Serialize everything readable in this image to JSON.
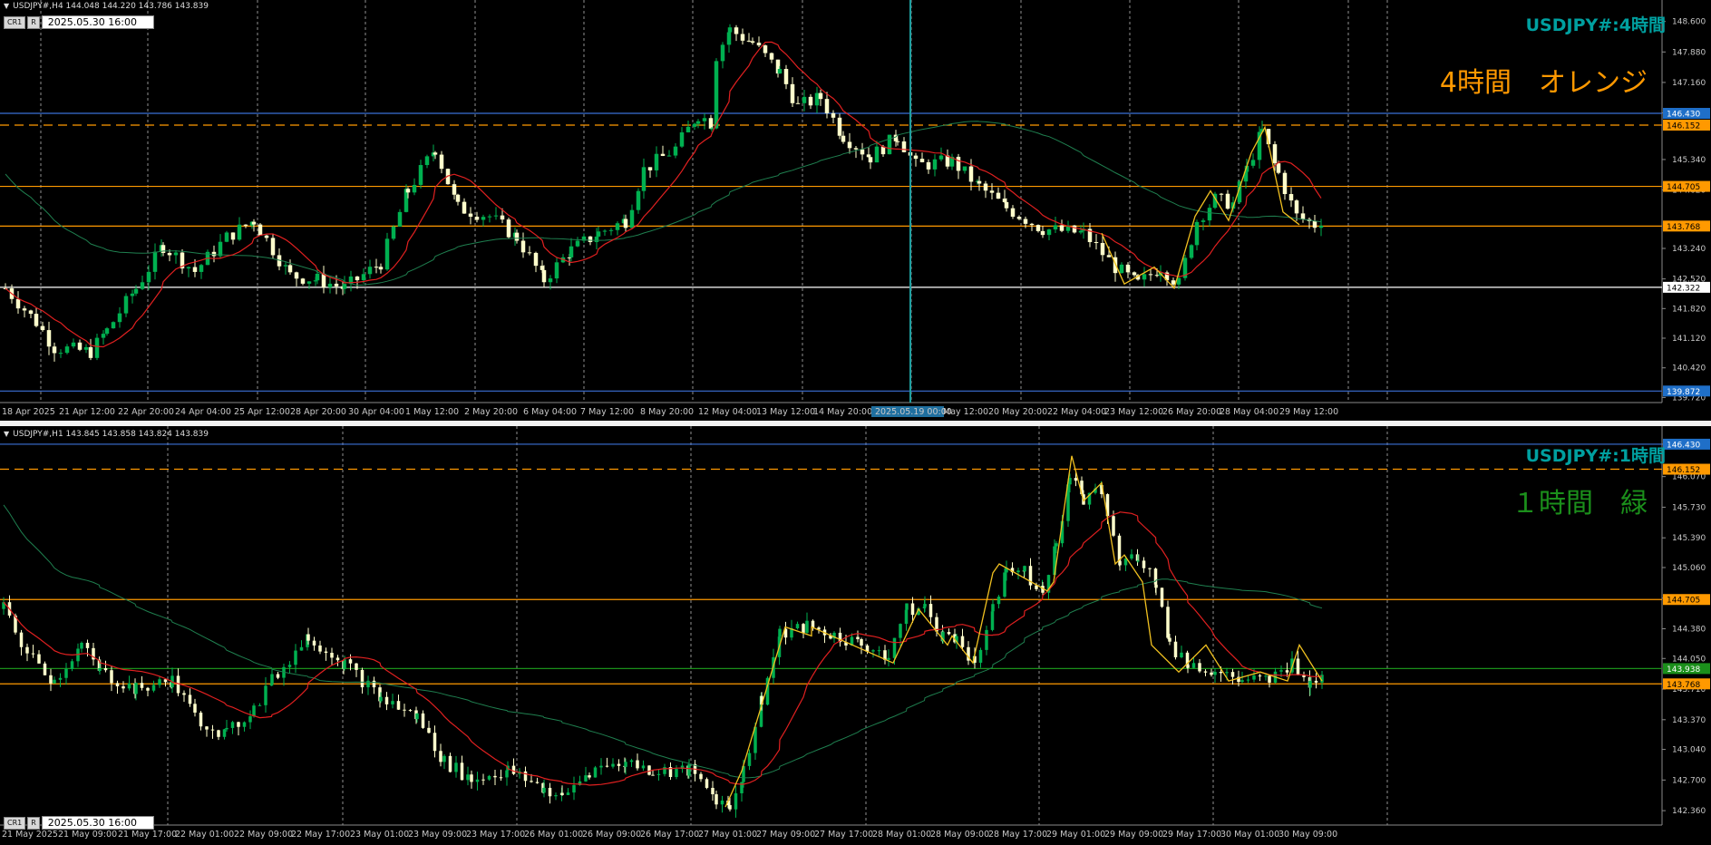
{
  "top": {
    "header": "USDJPY#,H4  144.048 144.220 143.786 143.839",
    "toolbar": {
      "btn1": "CR1",
      "btn2": "R",
      "date": "2025.05.30 16:00"
    },
    "title": "USDJPY#:4時間",
    "label": "4時間　オレンジ",
    "price_ticks": [
      "148.600",
      "147.880",
      "147.160",
      "146.440",
      "145.340",
      "144.620",
      "143.240",
      "142.520",
      "141.820",
      "141.120",
      "140.420",
      "139.720"
    ],
    "hlines": [
      {
        "value": "146.430",
        "color": "#3b6fd6",
        "style": "solid",
        "tag_bg": "#1f6fc8"
      },
      {
        "value": "146.152",
        "color": "#ff9900",
        "style": "dashed",
        "tag_bg": "#ff9900"
      },
      {
        "value": "144.705",
        "color": "#ff9900",
        "style": "solid",
        "tag_bg": "#ff9900"
      },
      {
        "value": "143.768",
        "color": "#ff9900",
        "style": "solid",
        "tag_bg": "#ff9900"
      },
      {
        "value": "142.322",
        "color": "#ffffff",
        "style": "solid",
        "tag_bg": "#ffffff"
      },
      {
        "value": "139.872",
        "color": "#3b6fd6",
        "style": "solid",
        "tag_bg": "#1f6fc8"
      }
    ],
    "time_labels": [
      "18 Apr 2025",
      "21 Apr 12:00",
      "22 Apr 20:00",
      "24 Apr 04:00",
      "25 Apr 12:00",
      "28 Apr 20:00",
      "30 Apr 04:00",
      "1 May 12:00",
      "2 May 20:00",
      "6 May 04:00",
      "7 May 12:00",
      "8 May 20:00",
      "12 May 04:00",
      "13 May 12:00",
      "14 May 20:00",
      "2025.05.19 00:00",
      "May 12:00",
      "20 May 20:00",
      "22 May 04:00",
      "23 May 12:00",
      "26 May 20:00",
      "28 May 04:00",
      "29 May 12:00"
    ],
    "crosshair_time": "2025.05.19 00:00"
  },
  "bottom": {
    "header": "USDJPY#,H1  143.845 143.858 143.824 143.839",
    "toolbar": {
      "btn1": "CR1",
      "btn2": "R",
      "date": "2025.05.30 16:00"
    },
    "title": "USDJPY#:1時間",
    "label": "１時間　緑",
    "price_ticks": [
      "146.430",
      "146.070",
      "145.730",
      "145.390",
      "145.060",
      "144.720",
      "144.380",
      "144.050",
      "143.710",
      "143.370",
      "143.040",
      "142.700",
      "142.360"
    ],
    "hlines": [
      {
        "value": "146.430",
        "color": "#3b6fd6",
        "style": "solid",
        "tag_bg": "#1f6fc8"
      },
      {
        "value": "146.152",
        "color": "#ff9900",
        "style": "dashed",
        "tag_bg": "#ff9900"
      },
      {
        "value": "144.705",
        "color": "#ff9900",
        "style": "solid",
        "tag_bg": "#ff9900"
      },
      {
        "value": "143.938",
        "color": "#1b8f1b",
        "style": "solid",
        "tag_bg": "#1b8f1b"
      },
      {
        "value": "143.768",
        "color": "#ff9900",
        "style": "solid",
        "tag_bg": "#ff9900"
      }
    ],
    "time_labels": [
      "21 May 2025",
      "21 May 09:00",
      "21 May 17:00",
      "22 May 01:00",
      "22 May 09:00",
      "22 May 17:00",
      "23 May 01:00",
      "23 May 09:00",
      "23 May 17:00",
      "26 May 01:00",
      "26 May 09:00",
      "26 May 17:00",
      "27 May 01:00",
      "27 May 09:00",
      "27 May 17:00",
      "28 May 01:00",
      "28 May 09:00",
      "28 May 17:00",
      "29 May 01:00",
      "29 May 09:00",
      "29 May 17:00",
      "30 May 01:00",
      "30 May 09:00"
    ]
  },
  "colors": {
    "bull": "#00b050",
    "bear": "#ffffcc",
    "ma_fast": "#e02020",
    "ma_slow": "#1f7f4f",
    "zigzag": "#f0c020",
    "grid": "#909090",
    "crosshair": "#1f9fa0"
  }
}
